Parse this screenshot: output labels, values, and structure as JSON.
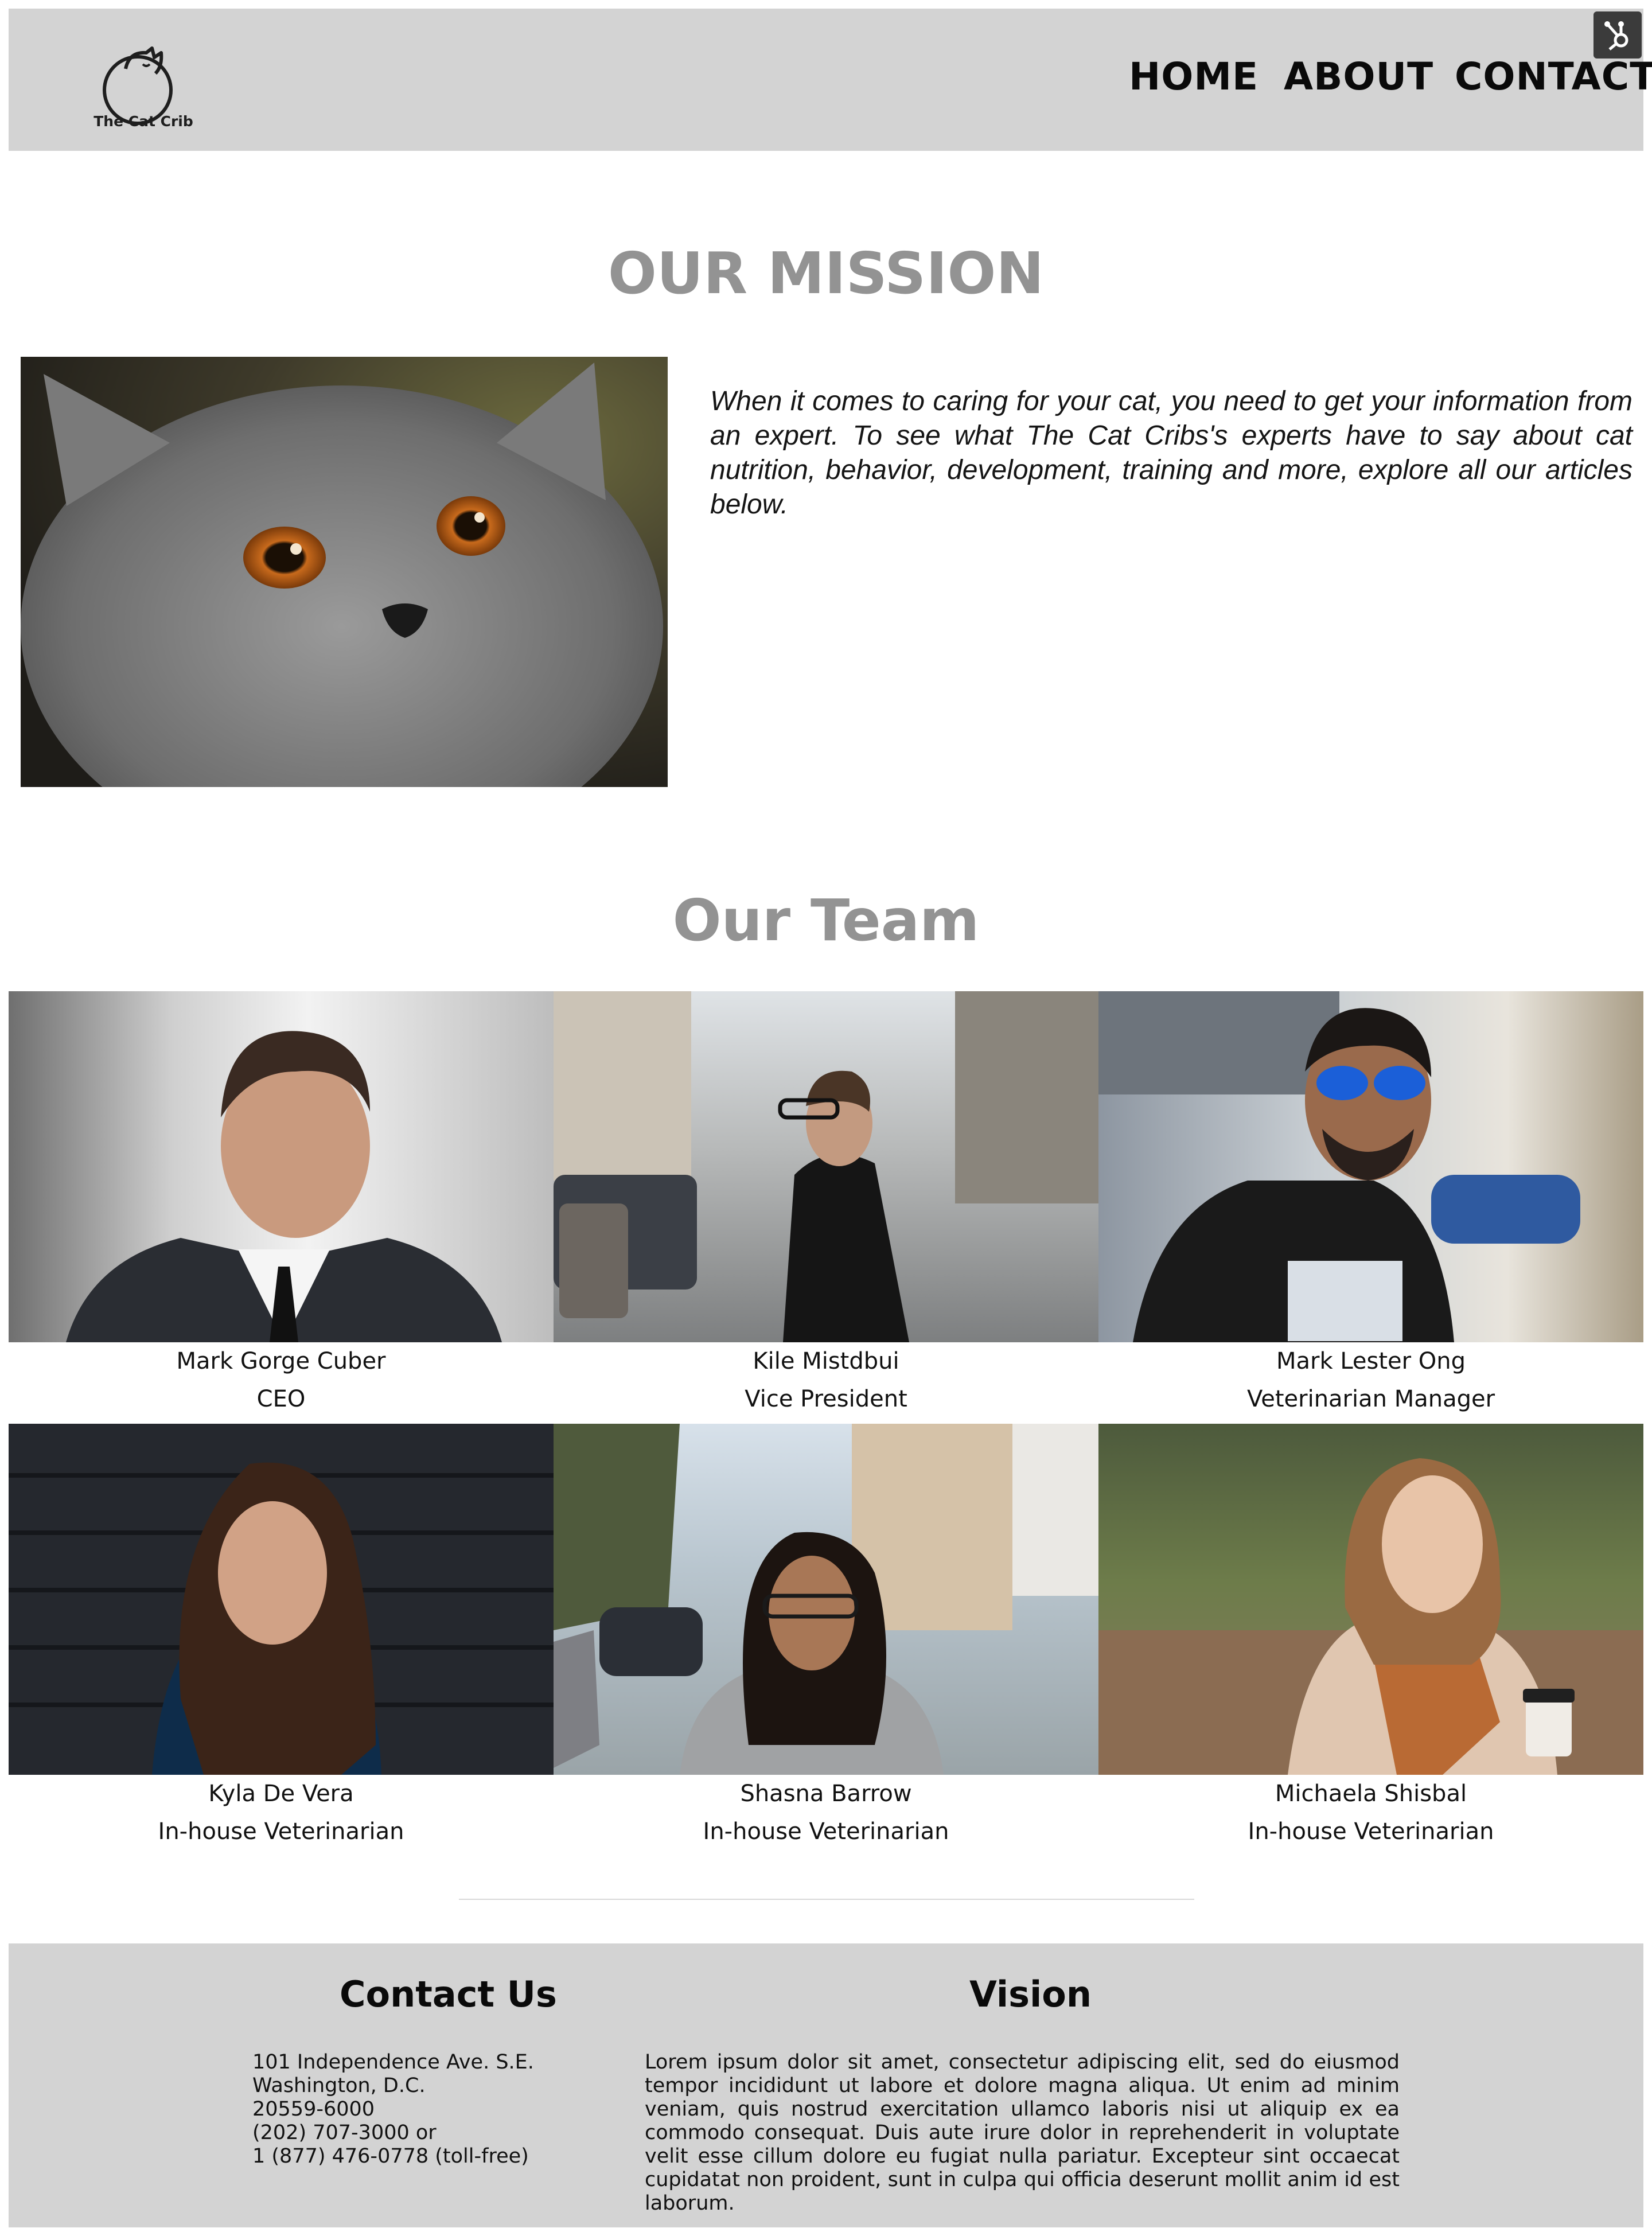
{
  "header": {
    "logo_text": "The Cat Crib",
    "nav": [
      "HOME",
      "ABOUT",
      "CONTACT"
    ]
  },
  "mission": {
    "title": "OUR MISSION",
    "text": "When it comes to caring for your cat, you need to get your information from an expert. To see what The Cat Cribs's experts have to say about cat nutrition, behavior, development, training and more, explore all our articles below."
  },
  "team": {
    "title": "Our Team",
    "members": [
      {
        "name": "Mark Gorge Cuber",
        "role": "CEO"
      },
      {
        "name": "Kile Mistdbui",
        "role": "Vice President"
      },
      {
        "name": "Mark Lester Ong",
        "role": "Veterinarian Manager"
      },
      {
        "name": "Kyla De Vera",
        "role": "In-house Veterinarian"
      },
      {
        "name": "Shasna Barrow",
        "role": "In-house Veterinarian"
      },
      {
        "name": "Michaela Shisbal",
        "role": "In-house Veterinarian"
      }
    ]
  },
  "footer": {
    "contact_title": "Contact Us",
    "address": [
      "101 Independence Ave. S.E.",
      "Washington, D.C.",
      "20559-6000",
      "(202) 707-3000 or",
      "1 (877) 476-0778 (toll-free)"
    ],
    "vision_title": "Vision",
    "vision_text": "Lorem ipsum dolor sit amet, consectetur adipiscing elit, sed do eiusmod tempor incididunt ut labore et dolore magna aliqua. Ut enim ad minim veniam, quis nostrud exercitation ullamco laboris nisi ut aliquip ex ea commodo consequat. Duis aute irure dolor in reprehenderit in voluptate velit esse cillum dolore eu fugiat nulla pariatur. Excepteur sint occaecat cupidatat non proident, sunt in culpa qui officia deserunt mollit anim id est laborum."
  }
}
